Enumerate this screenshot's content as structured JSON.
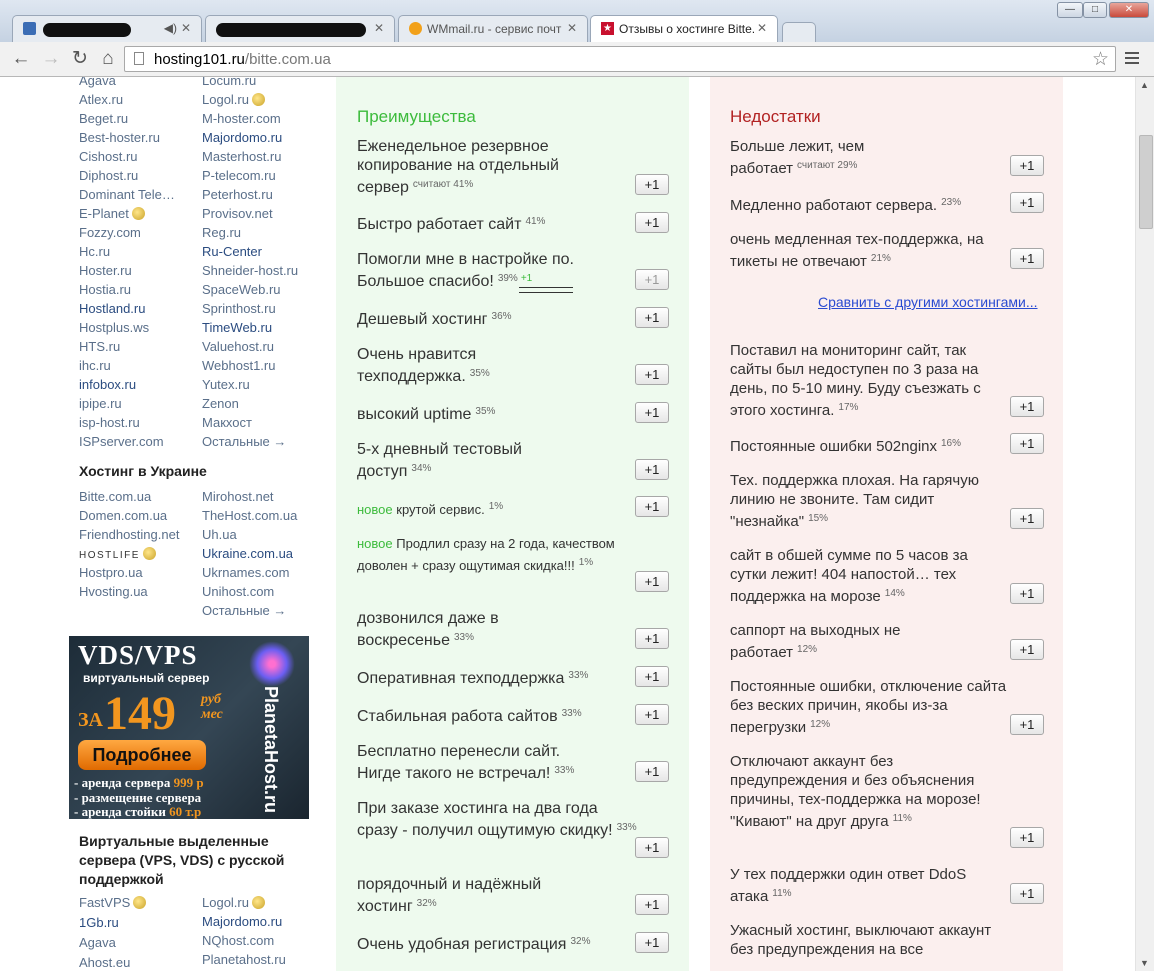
{
  "browser": {
    "tabs": [
      {
        "title": "",
        "active": false
      },
      {
        "title": "",
        "active": false
      },
      {
        "title": "WMmail.ru - сервис почт",
        "active": false
      },
      {
        "title": "Отзывы о хостинге Bitte.c",
        "active": true
      }
    ],
    "url_host": "hosting101.ru",
    "url_path": "/bitte.com.ua",
    "window_controls": {
      "minimize": "—",
      "maximize": "□",
      "close": "✕"
    }
  },
  "sidebar": {
    "hosting_list_col1": [
      "Agava",
      "Atlex.ru",
      "Beget.ru",
      "Best-hoster.ru",
      "Cishost.ru",
      "Diphost.ru",
      "Dominant Tele…",
      "E-Planet",
      "Fozzy.com",
      "Hc.ru",
      "Hoster.ru",
      "Hostia.ru",
      "Hostland.ru",
      "Hostplus.ws",
      "HTS.ru",
      "ihc.ru",
      "infobox.ru",
      "ipipe.ru",
      "isp-host.ru",
      "ISPserver.com"
    ],
    "hosting_list_col2": [
      "Locum.ru",
      "Logol.ru",
      "M-hoster.com",
      "Majordomo.ru",
      "Masterhost.ru",
      "P-telecom.ru",
      "Peterhost.ru",
      "Provisov.net",
      "Reg.ru",
      "Ru-Center",
      "Shneider-host.ru",
      "SpaceWeb.ru",
      "Sprinthost.ru",
      "TimeWeb.ru",
      "Valuehost.ru",
      "Webhost1.ru",
      "Yutex.ru",
      "Zenon",
      "Макхост",
      "Остальные →"
    ],
    "ukraine_heading": "Хостинг в Украине",
    "ukraine_col1": [
      "Bitte.com.ua",
      "Domen.com.ua",
      "Friendhosting.net",
      "HOSTLIFE",
      "Hostpro.ua",
      "Hvosting.ua"
    ],
    "ukraine_col2": [
      "Mirohost.net",
      "TheHost.com.ua",
      "Uh.ua",
      "Ukraine.com.ua",
      "Ukrnames.com",
      "Unihost.com",
      "Остальные →"
    ],
    "ad": {
      "title": "VDS/VPS",
      "subtitle": "виртуальный сервер",
      "za": "ЗА",
      "price": "149",
      "unit_line1": "руб",
      "unit_line2": "мес",
      "button": "Подробнее",
      "brand": "PlanetaHost.ru",
      "lines": [
        {
          "text": "- аренда сервера ",
          "accent": "999 р"
        },
        {
          "text": "- размещение сервера",
          "accent": ""
        },
        {
          "text": "- аренда стойки ",
          "accent": "60 т.р"
        }
      ]
    },
    "vps_heading": "Виртуальные выделенные сервера (VPS, VDS) с русской поддержкой",
    "vps_col1": [
      "FastVPS",
      "1Gb.ru",
      "Agava",
      "Ahost.eu"
    ],
    "vps_col2": [
      "Logol.ru",
      "Majordomo.ru",
      "NQhost.com",
      "Planetahost.ru"
    ]
  },
  "pros": {
    "title": "Преимущества",
    "vote_label": "+1",
    "items": [
      {
        "text": "Еженедельное резервное копирование на отдельный сервер",
        "pct": "считают 41%"
      },
      {
        "text": "Быстро работает сайт",
        "pct": "41%"
      },
      {
        "text": "Помогли мне в настройке по. Большое спасибо!",
        "pct": "39%",
        "extra": "+1"
      },
      {
        "text": "Дешевый хостинг",
        "pct": "36%"
      },
      {
        "text": "Очень нравится техподдержка.",
        "pct": "35%"
      },
      {
        "text": "высокий uptime",
        "pct": "35%"
      },
      {
        "text": "5-х дневный тестовый доступ",
        "pct": "34%"
      },
      {
        "new": "новое",
        "text": " крутой сервис.",
        "pct": "1%"
      },
      {
        "new": "новое",
        "text": " Продлил сразу на 2 года, качеством доволен + сразу ощутимая скидка!!!",
        "pct": "1%"
      },
      {
        "text": "дозвонился даже в воскресенье",
        "pct": "33%"
      },
      {
        "text": "Оперативная техподдержка",
        "pct": "33%"
      },
      {
        "text": "Стабильная работа сайтов",
        "pct": "33%"
      },
      {
        "text": "Бесплатно перенесли сайт. Нигде такого не встречал!",
        "pct": "33%"
      },
      {
        "text": "При заказе хостинга на два года сразу - получил ощутимую скидку!",
        "pct": "33%"
      },
      {
        "text": "порядочный и надёжный хостинг",
        "pct": "32%"
      },
      {
        "text": "Очень удобная регистрация",
        "pct": "32%"
      }
    ]
  },
  "cons": {
    "title": "Недостатки",
    "vote_label": "+1",
    "compare_link": "Сравнить с другими хостингами...",
    "items": [
      {
        "text": "Больше лежит, чем работает",
        "pct": "считают 29%"
      },
      {
        "text": "Медленно работают сервера.",
        "pct": "23%"
      },
      {
        "text": "очень медленная тех-поддержка, на тикеты не отвечают",
        "pct": "21%"
      },
      {
        "text": "Поставил на мониторинг сайт, так сайты был недоступен по 3 раза на день, по 5-10 мину. Буду съезжать с этого хостинга.",
        "pct": "17%"
      },
      {
        "text": "Постоянные ошибки 502nginx",
        "pct": "16%"
      },
      {
        "text": "Тех. поддержка плохая. На гарячую линию не звоните. Там сидит \"незнайка\"",
        "pct": "15%"
      },
      {
        "text": "сайт в обшей сумме по 5 часов за сутки лежит! 404 напостой… тех поддержка на морозе",
        "pct": "14%"
      },
      {
        "text": "саппорт на выходных не работает",
        "pct": "12%"
      },
      {
        "text": "Постоянные ошибки, отключение сайта без веских причин, якобы из-за перегрузки",
        "pct": "12%"
      },
      {
        "text": "Отключают аккаунт без предупреждения и без объяснения причины, тех-поддержка на морозе! \"Кивают\" на друг друга",
        "pct": "11%"
      },
      {
        "text": "У тех поддержки один ответ DdoS атака",
        "pct": "11%"
      },
      {
        "text": "Ужасный хостинг, выключают аккаунт без предупреждения на все",
        "pct": ""
      }
    ]
  }
}
